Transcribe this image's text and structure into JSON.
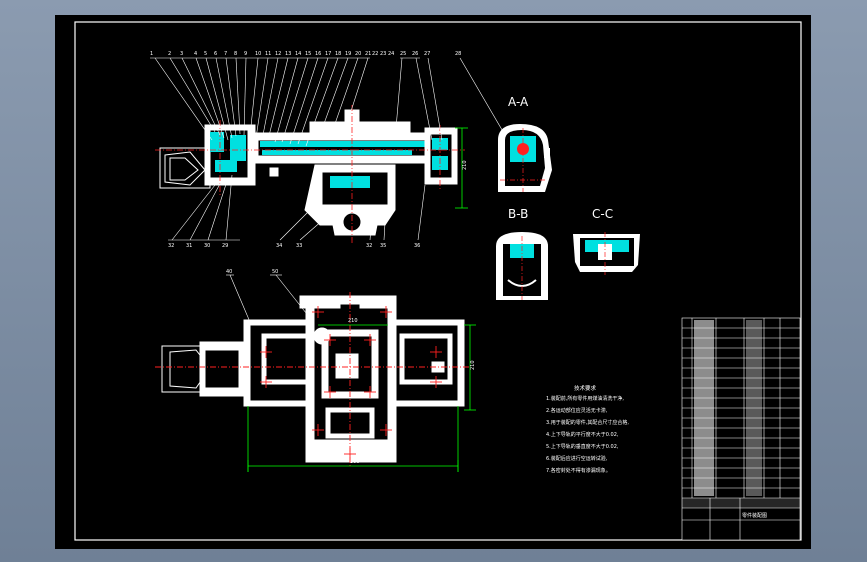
{
  "colors": {
    "background": "#000000",
    "outline": "#ffffff",
    "section_fill": "#00e0e0",
    "dimension": "#00ff00",
    "centerline": "#ff2020",
    "leader": "#ffffff",
    "frame_grey": "#7f8fa3"
  },
  "drawing": {
    "part_numbers_top": [
      "1",
      "2",
      "3",
      "4",
      "5",
      "6",
      "7",
      "8",
      "9",
      "10",
      "11",
      "12",
      "13",
      "14",
      "15",
      "16",
      "17",
      "18",
      "19",
      "20",
      "21",
      "22",
      "23",
      "24",
      "25",
      "26",
      "27",
      "28"
    ],
    "part_numbers_bottom": [
      "32",
      "31",
      "30",
      "29",
      "34",
      "33",
      "32",
      "35",
      "36"
    ],
    "plan_view_labels": [
      "40",
      "50"
    ],
    "section_titles": {
      "a": "A-A",
      "b": "B-B",
      "c": "C-C"
    },
    "dimension_labels": {
      "side_height": "210",
      "plan_height": "210",
      "plan_width": "300",
      "plan_inner": "210"
    },
    "tech_notes_title": "技术要求",
    "tech_notes": [
      "1.装配前,所有零件用煤油清洗干净,",
      "2.各运动部位应灵活无卡滞,",
      "3.用于装配的零件,其配合尺寸应合格,",
      "4.上下导轨的平行度不大于0.02,",
      "5.上下导轨的垂直度不大于0.02,",
      "6.装配后应进行空运转试验,",
      "7.各密封处不得有渗漏现象。"
    ]
  },
  "title_block": {
    "drawing_title": "零件装配图"
  }
}
